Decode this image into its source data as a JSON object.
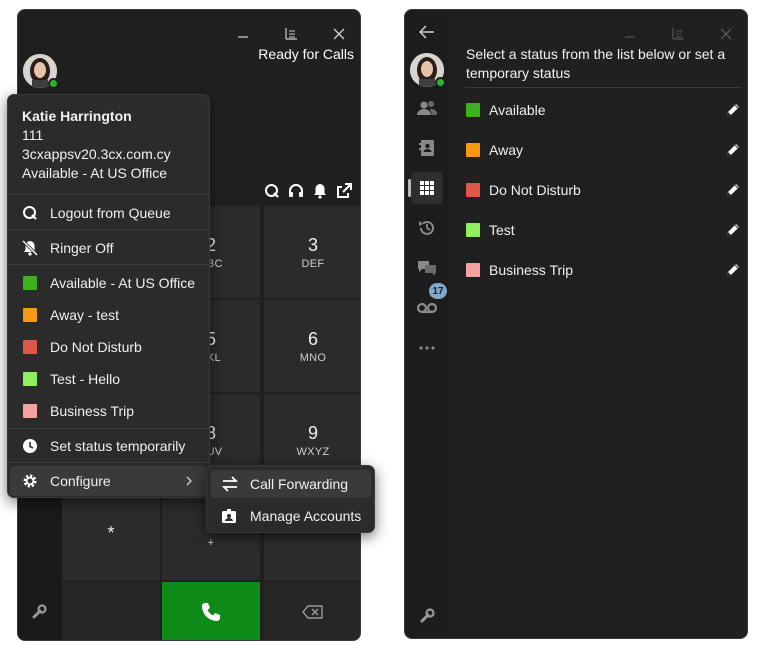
{
  "left_window": {
    "status_text": "Ready for Calls",
    "keypad": [
      {
        "digit": "2",
        "letters": "ABC"
      },
      {
        "digit": "3",
        "letters": "DEF"
      },
      {
        "digit": "5",
        "letters": "JKL"
      },
      {
        "digit": "6",
        "letters": "MNO"
      },
      {
        "digit": "8",
        "letters": "TUV"
      },
      {
        "digit": "9",
        "letters": "WXYZ"
      },
      {
        "digit": "*",
        "letters": ""
      },
      {
        "digit": "",
        "letters": "+"
      }
    ],
    "menu": {
      "user_name": "Katie Harrington",
      "extension": "111",
      "server": "3cxappsv20.3cx.com.cy",
      "current_status": "Available - At US Office",
      "logout_queue": "Logout from Queue",
      "ringer_off": "Ringer Off",
      "statuses": [
        {
          "label": "Available - At US Office",
          "color": "#3cb01e"
        },
        {
          "label": "Away - test",
          "color": "#f59a12"
        },
        {
          "label": "Do Not Disturb",
          "color": "#e0574a"
        },
        {
          "label": "Test - Hello",
          "color": "#8ef05e"
        },
        {
          "label": "Business Trip",
          "color": "#f4a2a2"
        }
      ],
      "set_temporary": "Set status temporarily",
      "configure": "Configure"
    },
    "submenu": {
      "call_forwarding": "Call Forwarding",
      "manage_accounts": "Manage Accounts"
    }
  },
  "right_window": {
    "prompt": "Select a status from the list below or set a temporary status",
    "statuses": [
      {
        "label": "Available",
        "color": "#3cb01e"
      },
      {
        "label": "Away",
        "color": "#f59a12"
      },
      {
        "label": "Do Not Disturb",
        "color": "#e0574a"
      },
      {
        "label": "Test",
        "color": "#8ef05e"
      },
      {
        "label": "Business Trip",
        "color": "#f4a2a2"
      }
    ],
    "voicemail_badge": "17"
  },
  "colors": {
    "window_bg": "#202020",
    "call_green": "#0e8a18",
    "presence_green": "#2db52d"
  }
}
